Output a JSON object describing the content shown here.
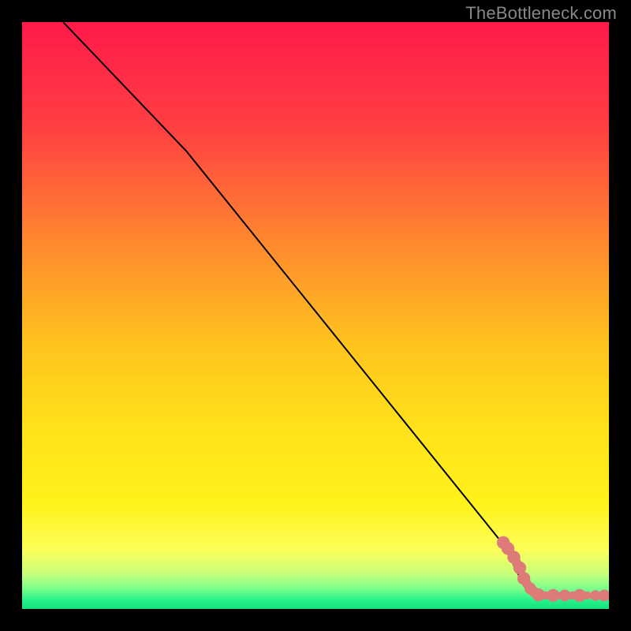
{
  "watermark": "TheBottleneck.com",
  "colors": {
    "background": "#000000",
    "line": "#000000",
    "marker_fill": "#dd7b78",
    "gradient_stops": [
      {
        "offset": 0.0,
        "color": "#ff1a4a"
      },
      {
        "offset": 0.18,
        "color": "#ff3f42"
      },
      {
        "offset": 0.38,
        "color": "#ff8a2e"
      },
      {
        "offset": 0.55,
        "color": "#ffc41e"
      },
      {
        "offset": 0.7,
        "color": "#ffe31a"
      },
      {
        "offset": 0.82,
        "color": "#fff21a"
      },
      {
        "offset": 0.9,
        "color": "#fcff5a"
      },
      {
        "offset": 0.94,
        "color": "#c8ff7a"
      },
      {
        "offset": 0.965,
        "color": "#7dff8a"
      },
      {
        "offset": 0.985,
        "color": "#28f28a"
      },
      {
        "offset": 1.0,
        "color": "#16e07f"
      }
    ]
  },
  "chart_data": {
    "type": "line",
    "title": "",
    "xlabel": "",
    "ylabel": "",
    "xlim": [
      0,
      100
    ],
    "ylim": [
      0,
      100
    ],
    "grid": false,
    "series": [
      {
        "name": "curve",
        "points": [
          {
            "x": 7.0,
            "y": 100.0
          },
          {
            "x": 28.0,
            "y": 78.0
          },
          {
            "x": 82.0,
            "y": 11.0
          },
          {
            "x": 85.5,
            "y": 4.0
          },
          {
            "x": 88.0,
            "y": 2.3
          },
          {
            "x": 100.0,
            "y": 2.3
          }
        ]
      }
    ],
    "markers": [
      {
        "x": 82.0,
        "y": 11.3,
        "r": 1.1
      },
      {
        "x": 82.8,
        "y": 10.3,
        "r": 1.1
      },
      {
        "x": 83.3,
        "y": 9.5,
        "r": 0.7
      },
      {
        "x": 83.8,
        "y": 8.8,
        "r": 1.1
      },
      {
        "x": 84.2,
        "y": 8.0,
        "r": 0.8
      },
      {
        "x": 84.8,
        "y": 7.0,
        "r": 1.1
      },
      {
        "x": 85.0,
        "y": 6.3,
        "r": 0.6
      },
      {
        "x": 85.5,
        "y": 5.2,
        "r": 1.1
      },
      {
        "x": 86.0,
        "y": 4.3,
        "r": 0.8
      },
      {
        "x": 86.6,
        "y": 3.5,
        "r": 1.0
      },
      {
        "x": 87.2,
        "y": 2.9,
        "r": 0.9
      },
      {
        "x": 88.0,
        "y": 2.4,
        "r": 1.1
      },
      {
        "x": 89.2,
        "y": 2.3,
        "r": 0.7
      },
      {
        "x": 90.5,
        "y": 2.3,
        "r": 1.1
      },
      {
        "x": 91.5,
        "y": 2.3,
        "r": 0.6
      },
      {
        "x": 92.5,
        "y": 2.3,
        "r": 1.0
      },
      {
        "x": 93.8,
        "y": 2.3,
        "r": 0.7
      },
      {
        "x": 95.0,
        "y": 2.3,
        "r": 1.1
      },
      {
        "x": 96.3,
        "y": 2.3,
        "r": 0.7
      },
      {
        "x": 97.7,
        "y": 2.3,
        "r": 0.9
      },
      {
        "x": 99.2,
        "y": 2.3,
        "r": 1.0
      }
    ]
  }
}
